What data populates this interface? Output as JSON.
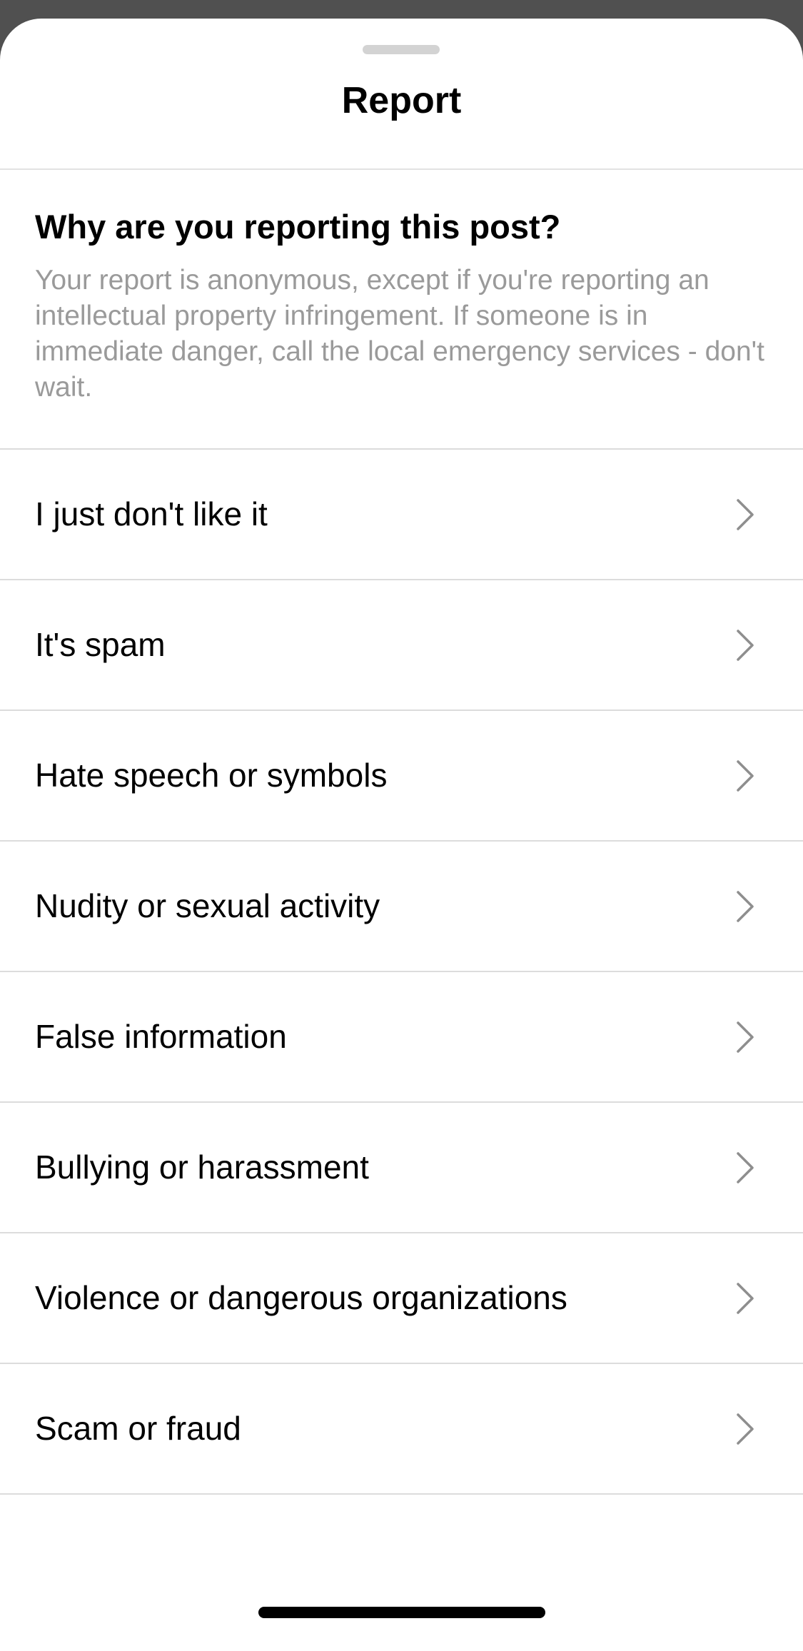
{
  "sheet": {
    "title": "Report"
  },
  "intro": {
    "heading": "Why are you reporting this post?",
    "description": "Your report is anonymous, except if you're reporting an intellectual property infringement. If someone is in immediate danger, call the local emergency services - don't wait."
  },
  "reasons": [
    {
      "label": "I just don't like it",
      "icon": "chevron-right-icon"
    },
    {
      "label": "It's spam",
      "icon": "chevron-right-icon"
    },
    {
      "label": "Hate speech or symbols",
      "icon": "chevron-right-icon"
    },
    {
      "label": "Nudity or sexual activity",
      "icon": "chevron-right-icon"
    },
    {
      "label": "False information",
      "icon": "chevron-right-icon"
    },
    {
      "label": "Bullying or harassment",
      "icon": "chevron-right-icon"
    },
    {
      "label": "Violence or dangerous organizations",
      "icon": "chevron-right-icon"
    },
    {
      "label": "Scam or fraud",
      "icon": "chevron-right-icon"
    }
  ],
  "colors": {
    "backdrop": "#505050",
    "sheet": "#ffffff",
    "text_primary": "#000000",
    "text_secondary": "#9a9a9a",
    "divider": "#dcdcdc",
    "chevron": "#8e8e8e"
  }
}
